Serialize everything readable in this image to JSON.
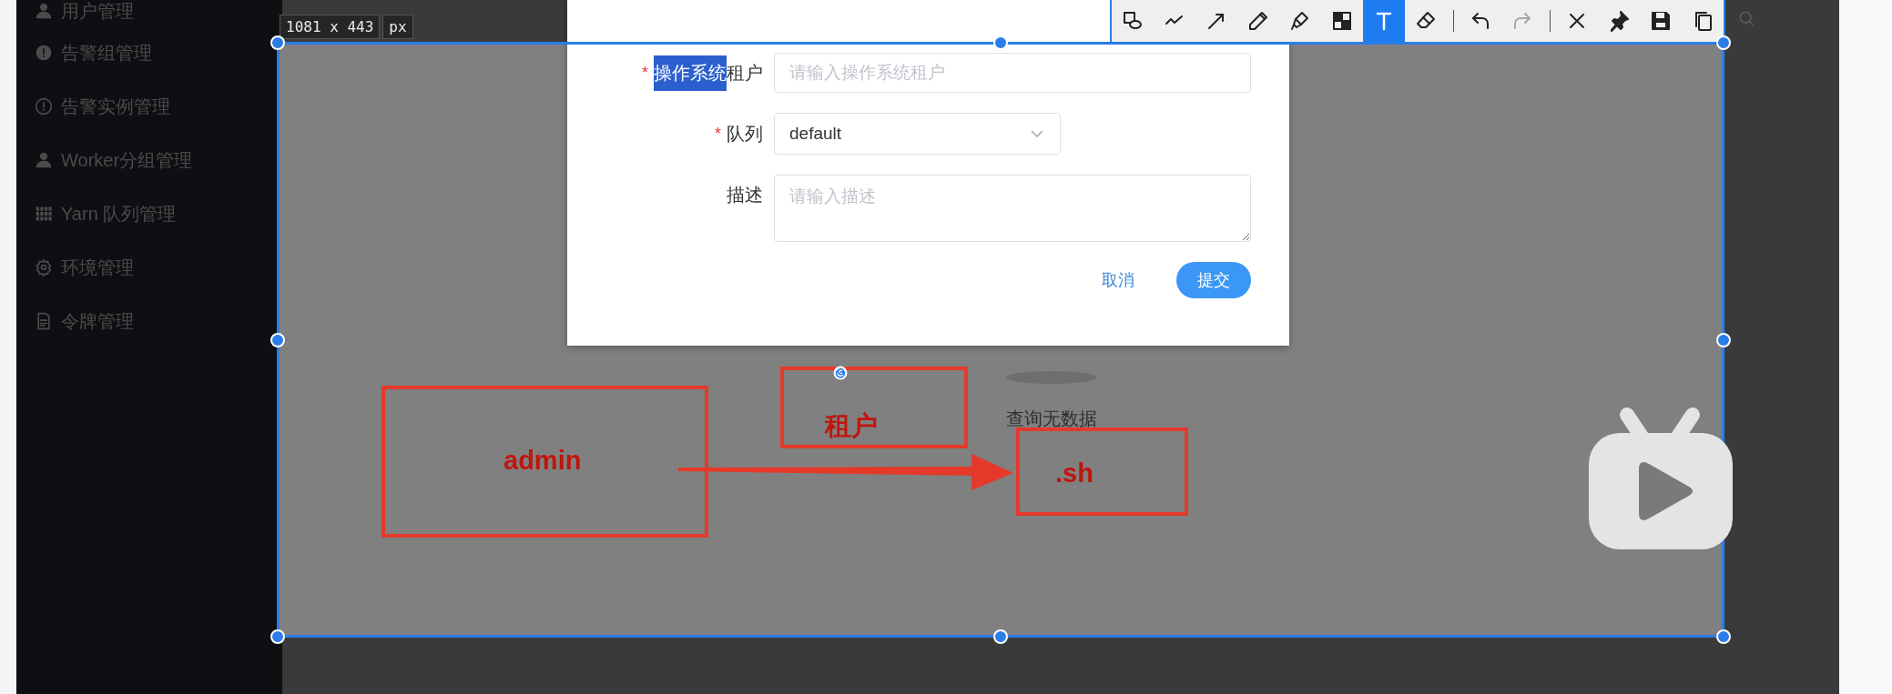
{
  "sidebar": {
    "items": [
      {
        "label": "用户管理"
      },
      {
        "label": "告警组管理"
      },
      {
        "label": "告警实例管理"
      },
      {
        "label": "Worker分组管理"
      },
      {
        "label": "Yarn 队列管理"
      },
      {
        "label": "环境管理"
      },
      {
        "label": "令牌管理"
      }
    ]
  },
  "capture": {
    "size_label": "1081 x 443",
    "unit": "px",
    "toolbar": [
      {
        "kind": "shapes",
        "selected": false,
        "disabled": false
      },
      {
        "kind": "line",
        "selected": false,
        "disabled": false
      },
      {
        "kind": "arrow",
        "selected": false,
        "disabled": false
      },
      {
        "kind": "pen",
        "selected": false,
        "disabled": false
      },
      {
        "kind": "marker",
        "selected": false,
        "disabled": false
      },
      {
        "kind": "mosaic",
        "selected": false,
        "disabled": false
      },
      {
        "kind": "text",
        "selected": true,
        "disabled": false
      },
      {
        "kind": "eraser",
        "selected": false,
        "disabled": false
      },
      {
        "kind": "separator"
      },
      {
        "kind": "undo",
        "selected": false,
        "disabled": false
      },
      {
        "kind": "redo",
        "selected": false,
        "disabled": true
      },
      {
        "kind": "separator"
      },
      {
        "kind": "close",
        "selected": false,
        "disabled": false
      },
      {
        "kind": "pin",
        "selected": false,
        "disabled": false
      },
      {
        "kind": "save",
        "selected": false,
        "disabled": false
      },
      {
        "kind": "copy",
        "selected": false,
        "disabled": false
      }
    ]
  },
  "dialog": {
    "fields": [
      {
        "kind": "input",
        "required_mark": "*",
        "label_parts": [
          {
            "text": "操作系统",
            "highlighted": true
          },
          {
            "text": "租户",
            "highlighted": false
          }
        ],
        "placeholder": "请输入操作系统租户"
      },
      {
        "kind": "select",
        "required_mark": "*",
        "label_parts": [
          {
            "text": "队列",
            "highlighted": false
          }
        ],
        "value": "default"
      },
      {
        "kind": "textarea",
        "label_parts": [
          {
            "text": "描述",
            "highlighted": false
          }
        ],
        "placeholder": "请输入描述"
      }
    ],
    "buttons": [
      {
        "kind": "text",
        "label": "取消"
      },
      {
        "kind": "primary",
        "label": "提交"
      }
    ]
  },
  "results": {
    "empty_text": "查询无数据"
  },
  "annotations": [
    {
      "kind": "rect",
      "text": "admin"
    },
    {
      "kind": "rect",
      "text": "租户"
    },
    {
      "kind": "rect",
      "text": ".sh"
    },
    {
      "kind": "arrow"
    }
  ]
}
